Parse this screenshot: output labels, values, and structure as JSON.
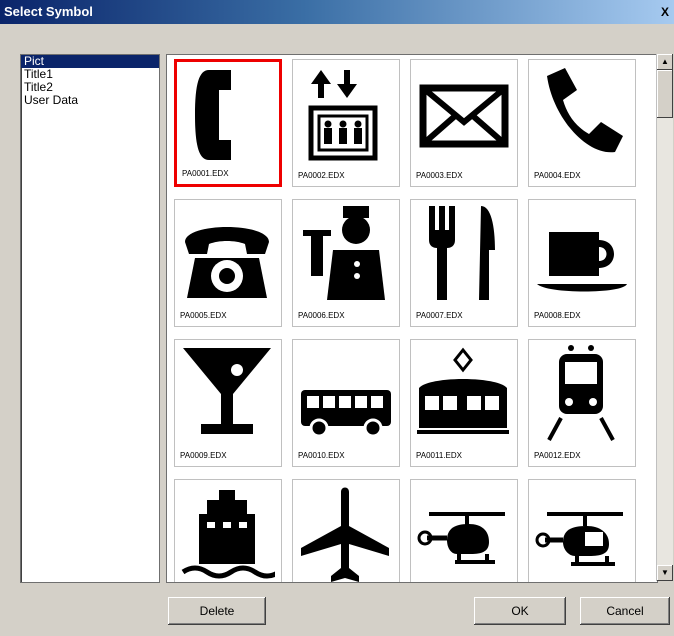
{
  "window": {
    "title": "Select Symbol",
    "close_label": "X"
  },
  "categories": [
    {
      "label": "Pict",
      "selected": true
    },
    {
      "label": "Title1",
      "selected": false
    },
    {
      "label": "Title2",
      "selected": false
    },
    {
      "label": "User Data",
      "selected": false
    }
  ],
  "symbols": [
    {
      "label": "PA0001.EDX",
      "icon": "phone-handset-icon",
      "selected": true
    },
    {
      "label": "PA0002.EDX",
      "icon": "elevator-icon",
      "selected": false
    },
    {
      "label": "PA0003.EDX",
      "icon": "envelope-icon",
      "selected": false
    },
    {
      "label": "PA0004.EDX",
      "icon": "telephone-receiver-icon",
      "selected": false
    },
    {
      "label": "PA0005.EDX",
      "icon": "rotary-phone-icon",
      "selected": false
    },
    {
      "label": "PA0006.EDX",
      "icon": "bellhop-icon",
      "selected": false
    },
    {
      "label": "PA0007.EDX",
      "icon": "fork-knife-icon",
      "selected": false
    },
    {
      "label": "PA0008.EDX",
      "icon": "coffee-cup-icon",
      "selected": false
    },
    {
      "label": "PA0009.EDX",
      "icon": "cocktail-glass-icon",
      "selected": false
    },
    {
      "label": "PA0010.EDX",
      "icon": "bus-icon",
      "selected": false
    },
    {
      "label": "PA0011.EDX",
      "icon": "tram-icon",
      "selected": false
    },
    {
      "label": "PA0012.EDX",
      "icon": "train-icon",
      "selected": false
    },
    {
      "label": "",
      "icon": "ship-icon",
      "selected": false
    },
    {
      "label": "",
      "icon": "airplane-icon",
      "selected": false
    },
    {
      "label": "",
      "icon": "helicopter-icon",
      "selected": false
    },
    {
      "label": "",
      "icon": "helicopter-icon",
      "selected": false
    }
  ],
  "buttons": {
    "delete": "Delete",
    "ok": "OK",
    "cancel": "Cancel"
  }
}
